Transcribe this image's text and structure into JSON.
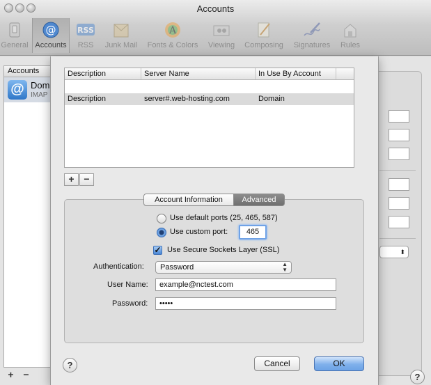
{
  "window": {
    "title": "Accounts"
  },
  "toolbar": {
    "items": [
      {
        "label": "General"
      },
      {
        "label": "Accounts"
      },
      {
        "label": "RSS"
      },
      {
        "label": "Junk Mail"
      },
      {
        "label": "Fonts & Colors"
      },
      {
        "label": "Viewing"
      },
      {
        "label": "Composing"
      },
      {
        "label": "Signatures"
      },
      {
        "label": "Rules"
      }
    ],
    "active": "Accounts",
    "rss_badge": "RSS"
  },
  "accounts_list": {
    "header": "Accounts",
    "items": [
      {
        "name": "Dom",
        "type": "IMAP",
        "icon": "at-icon"
      }
    ],
    "add_label": "+",
    "remove_label": "−"
  },
  "sheet": {
    "server_table": {
      "columns": [
        "Description",
        "Server Name",
        "In Use By Account"
      ],
      "rows": [
        {
          "description": "Description",
          "server": "server#.web-hosting.com",
          "account": "Domain"
        }
      ]
    },
    "add_label": "+",
    "remove_label": "−",
    "tabs": {
      "items": [
        "Account Information",
        "Advanced"
      ],
      "selected": "Advanced"
    },
    "ports": {
      "default_label": "Use default ports (25, 465, 587)",
      "custom_label": "Use custom port:",
      "custom_value": "465",
      "selected": "custom"
    },
    "ssl": {
      "label": "Use Secure Sockets Layer (SSL)",
      "checked": true,
      "check_glyph": "✓"
    },
    "authentication": {
      "label": "Authentication:",
      "value": "Password"
    },
    "username": {
      "label": "User Name:",
      "value": "example@nctest.com"
    },
    "password": {
      "label": "Password:",
      "value": "•••••"
    },
    "buttons": {
      "help": "?",
      "cancel": "Cancel",
      "ok": "OK"
    }
  },
  "window_help": "?",
  "colors": {
    "accent": "#6da3e6",
    "selection": "#dadada",
    "toolbar": "#cfcfcf"
  }
}
